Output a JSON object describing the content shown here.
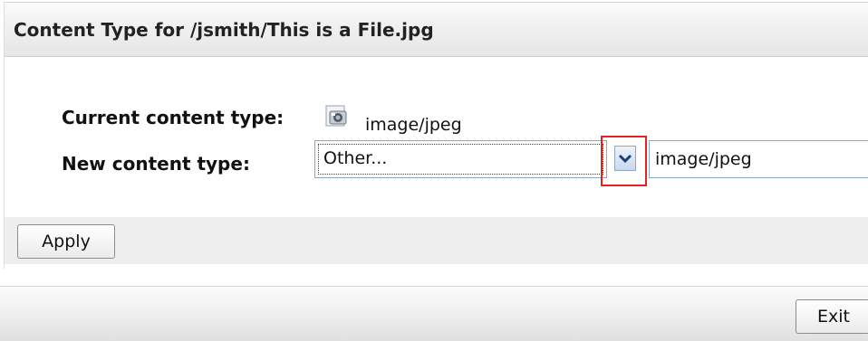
{
  "panel": {
    "title": "Content Type for /jsmith/This is a File.jpg"
  },
  "form": {
    "current_label": "Current content type:",
    "current_icon": "image-file-icon",
    "current_value": "image/jpeg",
    "new_label": "New content type:",
    "select_value": "Other...",
    "input_value": "image/jpeg",
    "highlight_color": "#e02424"
  },
  "actions": {
    "apply_label": "Apply"
  },
  "footer": {
    "exit_label": "Exit"
  }
}
